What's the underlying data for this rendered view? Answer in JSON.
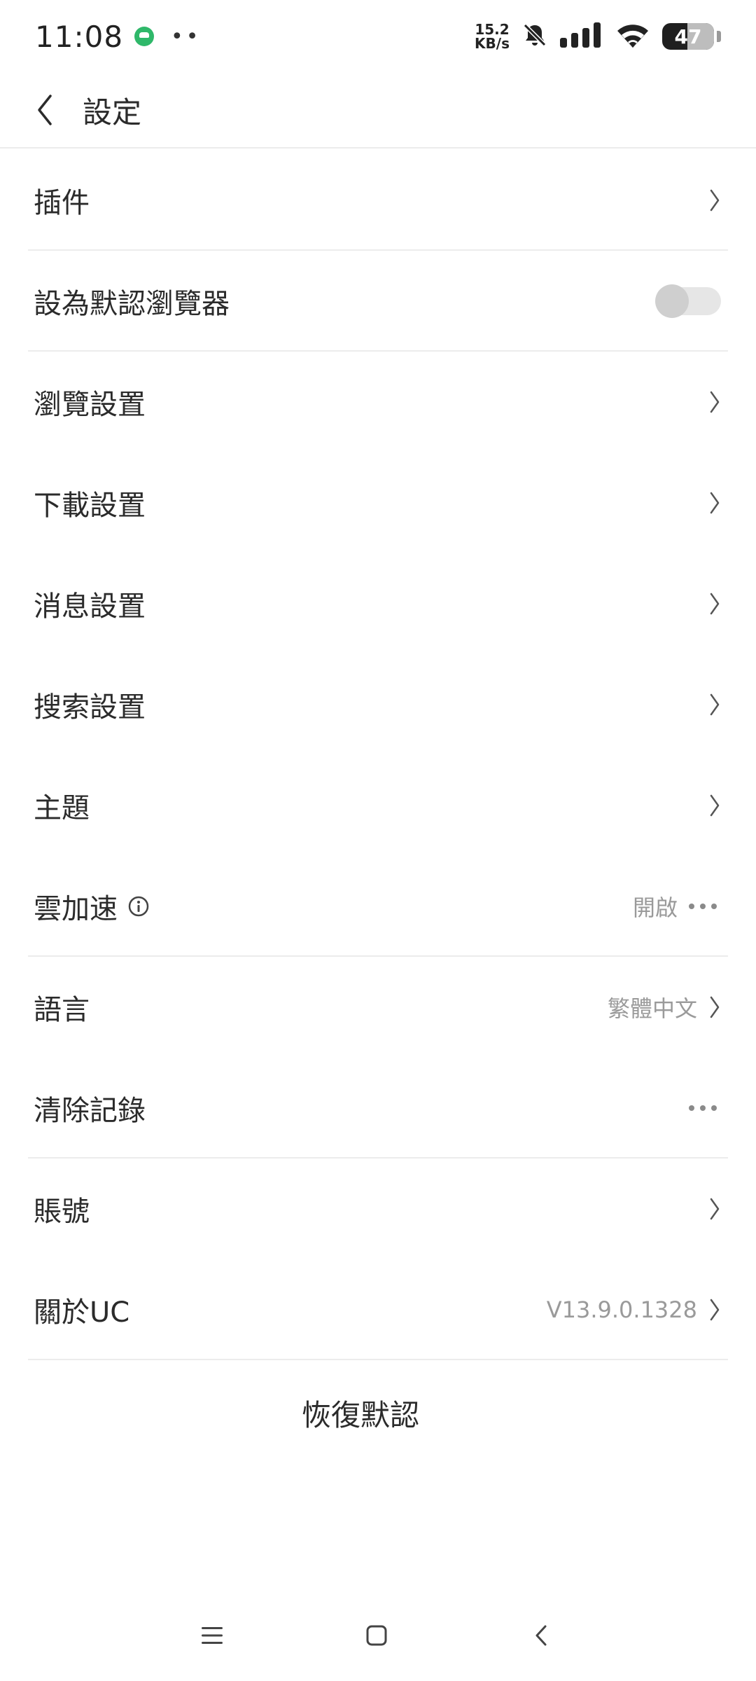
{
  "status_bar": {
    "time": "11:08",
    "dots": "••",
    "net_speed_value": "15.2",
    "net_speed_unit": "KB/s",
    "battery": "47"
  },
  "header": {
    "title": "設定"
  },
  "settings": {
    "plugins": "插件",
    "default_browser": "設為默認瀏覽器",
    "default_browser_enabled": false,
    "browse_settings": "瀏覽設置",
    "download_settings": "下載設置",
    "message_settings": "消息設置",
    "search_settings": "搜索設置",
    "theme": "主題",
    "cloud_accel": "雲加速",
    "cloud_accel_value": "開啟",
    "language": "語言",
    "language_value": "繁體中文",
    "clear_records": "清除記錄",
    "account": "賬號",
    "about": "關於UC",
    "about_value": "V13.9.0.1328"
  },
  "restore_default": "恢復默認",
  "icons": {
    "accent": "#2fb86a",
    "text": "#2b2b2b",
    "muted": "#9a9a9a"
  }
}
